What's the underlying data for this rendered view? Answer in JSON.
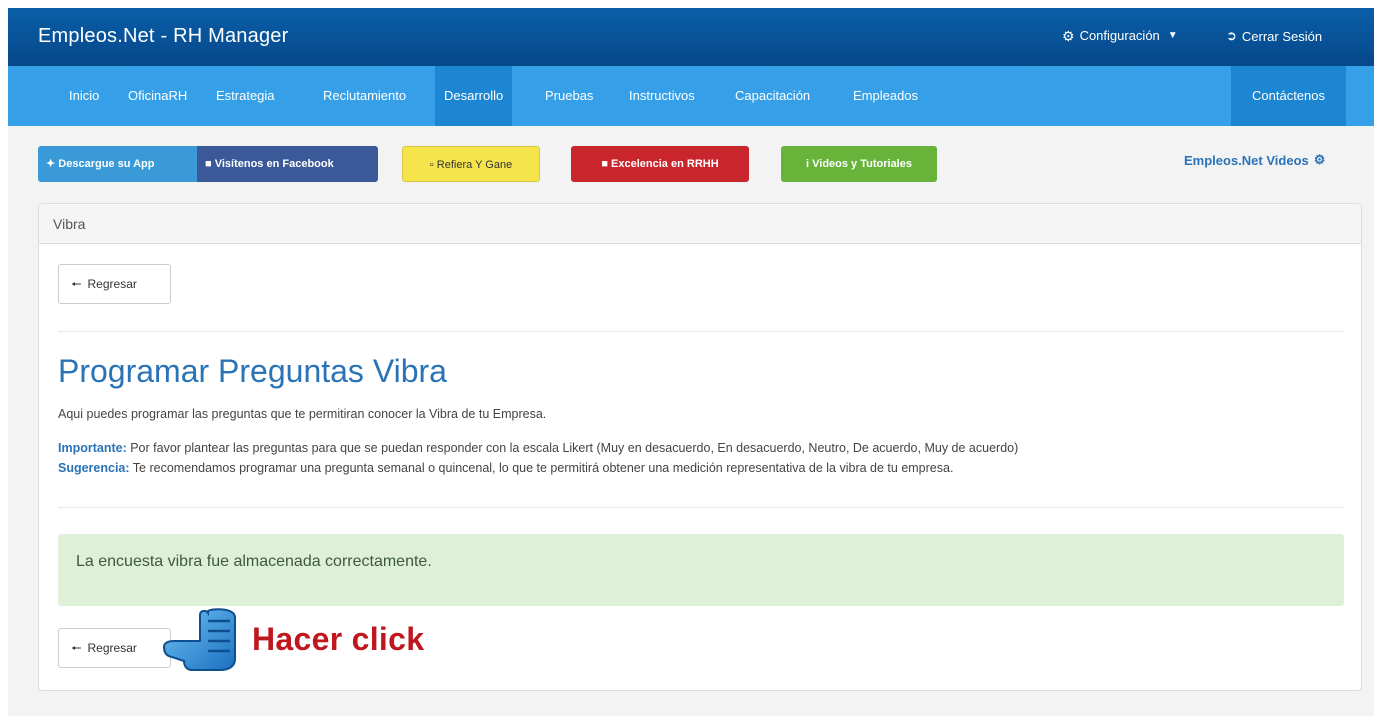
{
  "header": {
    "brand": "Empleos.Net - RH Manager",
    "config_label": "Configuración",
    "logout_label": "Cerrar Sesión"
  },
  "nav": {
    "items": [
      "Inicio",
      "OficinaRH",
      "Estrategia",
      "Reclutamiento",
      "Desarrollo",
      "Pruebas",
      "Instructivos",
      "Capacitación",
      "Empleados"
    ],
    "active": "Desarrollo",
    "contact": "Contáctenos"
  },
  "promo": {
    "app": "Descargue su App",
    "facebook": "Visítenos en Facebook",
    "refer": "Refiera Y Gane",
    "excellence": "Excelencia en RRHH",
    "videos": "Videos y Tutoriales",
    "videos_link": "Empleos.Net Videos"
  },
  "panel": {
    "title": "Vibra",
    "back_label": "Regresar",
    "heading": "Programar Preguntas Vibra",
    "intro": "Aqui puedes programar las preguntas que te permitiran conocer la Vibra de tu Empresa.",
    "important_label": "Importante:",
    "important_text": " Por favor plantear las preguntas para que se puedan responder con la escala Likert (Muy en desacuerdo, En desacuerdo, Neutro, De acuerdo, Muy de acuerdo)",
    "suggestion_label": "Sugerencia:",
    "suggestion_text": " Te recomendamos programar una pregunta semanal o quincenal, lo que te permitirá obtener una medición representativa de la vibra de tu empresa.",
    "alert": "La encuesta vibra fue almacenada correctamente."
  },
  "callout": {
    "text": "Hacer click"
  },
  "colors": {
    "topbar": "#0a5fa8",
    "navbar": "#35a0e7",
    "nav_active": "#1c86d2",
    "heading": "#2a73b7",
    "alert_bg": "#dff0d8",
    "callout": "#c0171f"
  }
}
